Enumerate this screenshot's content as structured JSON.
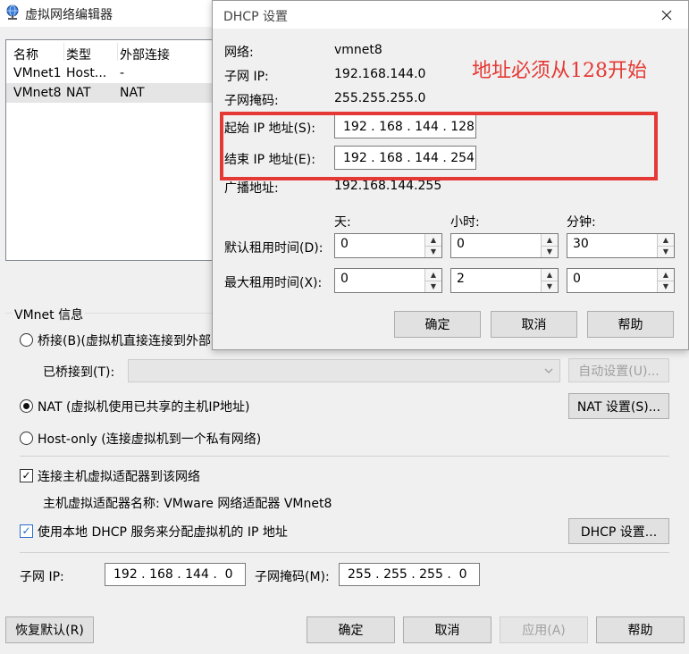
{
  "main_window": {
    "title": "虚拟网络编辑器",
    "table": {
      "headers": [
        "名称",
        "类型",
        "外部连接"
      ],
      "rows": [
        [
          "VMnet1",
          "Host...",
          "-"
        ],
        [
          "VMnet8",
          "NAT",
          "NAT"
        ]
      ]
    },
    "vmnet_info": {
      "group_label": "VMnet 信息",
      "bridged_label": "桥接(B)(虚拟机直接连接到外部网络)(D)",
      "bridged_to_label": "已桥接到(T):",
      "bridged_to_value": "",
      "auto_settings_button": "自动设置(U)...",
      "nat_label": "NAT (虚拟机使用已共享的主机IP地址)",
      "nat_settings_button": "NAT 设置(S)...",
      "host_only_label": "Host-only (连接虚拟机到一个私有网络)",
      "connect_adapter_label": "连接主机虚拟适配器到该网络",
      "connect_adapter_checked": true,
      "adapter_name_text": "主机虚拟适配器名称: VMware 网络适配器 VMnet8",
      "dhcp_label": "使用本地 DHCP 服务来分配虚拟机的 IP 地址",
      "dhcp_checked": true,
      "dhcp_settings_button": "DHCP 设置...",
      "subnet_ip_label": "子网 IP:",
      "subnet_ip_value": "192 . 168 . 144 .  0",
      "subnet_mask_label": "子网掩码(M):",
      "subnet_mask_value": "255 . 255 . 255 .  0",
      "selected_mode": "nat"
    },
    "buttons": {
      "restore_defaults": "恢复默认(R)",
      "ok": "确定",
      "cancel": "取消",
      "apply": "应用(A)",
      "help": "帮助"
    }
  },
  "dhcp_dialog": {
    "title": "DHCP 设置",
    "close_icon": "close-icon",
    "network_label": "网络:",
    "network_value": "vmnet8",
    "subnet_ip_label": "子网 IP:",
    "subnet_ip_value": "192.168.144.0",
    "subnet_mask_label": "子网掩码:",
    "subnet_mask_value": "255.255.255.0",
    "start_ip_label": "起始 IP 地址(S):",
    "start_ip_value": "192 . 168 . 144 . 128",
    "end_ip_label": "结束 IP 地址(E):",
    "end_ip_value": "192 . 168 . 144 . 254",
    "broadcast_label": "广播地址:",
    "broadcast_value": "192.168.144.255",
    "col_days": "天:",
    "col_hours": "小时:",
    "col_minutes": "分钟:",
    "default_lease_label": "默认租用时间(D):",
    "default_lease": {
      "days": "0",
      "hours": "0",
      "minutes": "30"
    },
    "max_lease_label": "最大租用时间(X):",
    "max_lease": {
      "days": "0",
      "hours": "2",
      "minutes": "0"
    },
    "buttons": {
      "ok": "确定",
      "cancel": "取消",
      "help": "帮助"
    }
  },
  "annotation": {
    "text": "地址必须从128开始",
    "color": "#e53935"
  }
}
